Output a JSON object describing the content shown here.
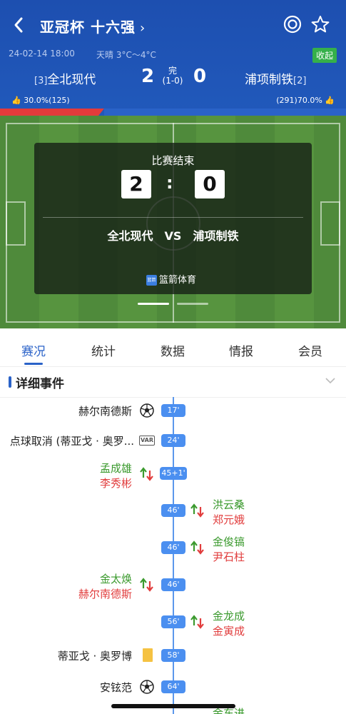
{
  "header": {
    "title": "亚冠杯 十六强",
    "datetime": "24-02-14 18:00",
    "weather": "天晴 3°C～4°C",
    "collapse_label": "收起",
    "home_team": "全北现代",
    "home_rank": "[3]",
    "away_team": "浦项制铁",
    "away_rank": "[2]",
    "home_score": "2",
    "away_score": "0",
    "status": "完",
    "halftime": "(1-0)",
    "home_vote": "30.0%(125)",
    "away_vote": "(291)70.0%",
    "home_vote_share": 0.3
  },
  "panel": {
    "title": "比赛结束",
    "home_score": "2",
    "away_score": "0",
    "colon": ":",
    "home_team": "全北现代",
    "vs": "VS",
    "away_team": "浦项制铁",
    "brand_logo": "篮箭",
    "brand": "篮箭体育"
  },
  "tabs": [
    "赛况",
    "统计",
    "数据",
    "情报",
    "会员"
  ],
  "section_title": "详细事件",
  "events": [
    {
      "time": "17'",
      "side": "home",
      "type": "goal",
      "player": "赫尔南德斯"
    },
    {
      "time": "24'",
      "side": "home",
      "type": "var",
      "player": "点球取消 (蒂亚戈 · 奥罗...",
      "var_label": "VAR"
    },
    {
      "time": "45+1'",
      "side": "home",
      "type": "sub",
      "in": "孟成雄",
      "out": "李秀彬"
    },
    {
      "time": "46'",
      "side": "away",
      "type": "sub",
      "in": "洪云桑",
      "out": "郑元娥"
    },
    {
      "time": "46'",
      "side": "away",
      "type": "sub",
      "in": "金俊镐",
      "out": "尹石柱"
    },
    {
      "time": "46'",
      "side": "home",
      "type": "sub",
      "in": "金太焕",
      "out": "赫尔南德斯"
    },
    {
      "time": "56'",
      "side": "away",
      "type": "sub",
      "in": "金龙成",
      "out": "金寅成"
    },
    {
      "time": "58'",
      "side": "home",
      "type": "yellow",
      "player": "蒂亚戈 · 奥罗博"
    },
    {
      "time": "64'",
      "side": "home",
      "type": "goal",
      "player": "安铉范"
    },
    {
      "time": "",
      "side": "away",
      "type": "sub",
      "in": "金东进",
      "out": ""
    }
  ],
  "colors": {
    "header": "#2159bb",
    "accent": "#2a62c8",
    "sub_in": "#3b9a2e",
    "sub_out": "#e13c3c",
    "time_badge": "#4b8ff0",
    "yellow": "#f5c242",
    "home_bar": "#e33b3b",
    "away_bar": "#2a62c8"
  },
  "icons": {
    "back": "chevron-left-icon",
    "target": "target-icon",
    "favorite": "star-icon",
    "goal": "football-icon",
    "sub": "substitution-icon",
    "var": "var-icon",
    "card": "yellow-card-icon"
  }
}
